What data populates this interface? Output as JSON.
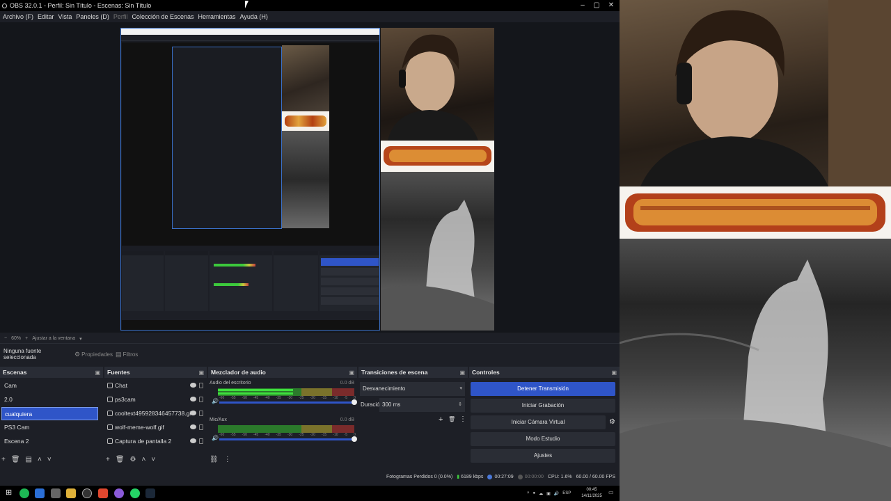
{
  "window": {
    "title": "OBS 32.0.1 - Perfil: Sin Título - Escenas: Sin Título",
    "minimize": "‒",
    "maximize": "▢",
    "close": "✕"
  },
  "menu": {
    "archivo": "Archivo (F)",
    "editar": "Editar",
    "vista": "Vista",
    "paneles": "Paneles (D)",
    "perfil": "Perfil",
    "coleccion": "Colección de Escenas",
    "herramientas": "Herramientas",
    "ayuda": "Ayuda (H)"
  },
  "zoom": {
    "minus": "−",
    "value": "60%",
    "plus": "+",
    "fit": "Ajustar a la ventana"
  },
  "source_toolbar": {
    "no_selection": "Ninguna fuente seleccionada",
    "properties": "Propiedades",
    "filters": "Filtros"
  },
  "docks": {
    "scenes_title": "Escenas",
    "sources_title": "Fuentes",
    "mixer_title": "Mezclador de audio",
    "transitions_title": "Transiciones de escena",
    "controls_title": "Controles"
  },
  "scenes": [
    {
      "label": "Cam"
    },
    {
      "label": "2.0"
    },
    {
      "label": "cualquiera"
    },
    {
      "label": "PS3 Cam"
    },
    {
      "label": "Escena 2"
    }
  ],
  "sources": [
    {
      "label": "Chat"
    },
    {
      "label": "ps3cam"
    },
    {
      "label": "cooltext495928346457738.gif"
    },
    {
      "label": "wolf-meme-wolf.gif"
    },
    {
      "label": "Captura de pantalla 2"
    }
  ],
  "mixer": {
    "tracks": [
      {
        "name": "Audio del escritorio",
        "db": "0.0 dB",
        "level": 0.55,
        "volume": 1.0
      },
      {
        "name": "Mic/Aux",
        "db": "0.0 dB",
        "level": 0.0,
        "volume": 1.0
      }
    ],
    "ticks": [
      "-60",
      "-55",
      "-50",
      "-45",
      "-40",
      "-35",
      "-30",
      "-25",
      "-20",
      "-15",
      "-10",
      "-5",
      "0"
    ]
  },
  "transitions": {
    "selected": "Desvanecimiento",
    "duration_label": "Duración",
    "duration_value": "300 ms"
  },
  "controls": {
    "stop_stream": "Detener Transmisión",
    "start_recording": "Iniciar Grabación",
    "start_virtual_cam": "Iniciar Cámara Virtual",
    "studio_mode": "Modo Estudio",
    "settings": "Ajustes"
  },
  "status": {
    "dropped_frames": "Fotogramas Perdidos 0 (0.0%)",
    "bitrate": "6189 kbps",
    "stream_time": "00:27:09",
    "rec_time": "00:00:00",
    "cpu": "CPU: 1.6%",
    "fps": "60.00 / 60.00 FPS"
  },
  "taskbar": {
    "language": "ESP",
    "time": "00:45",
    "date": "14/11/2025"
  },
  "colors": {
    "accent": "#2f55c8",
    "panel_bg": "#1d1f26",
    "header_bg": "#292c35"
  }
}
